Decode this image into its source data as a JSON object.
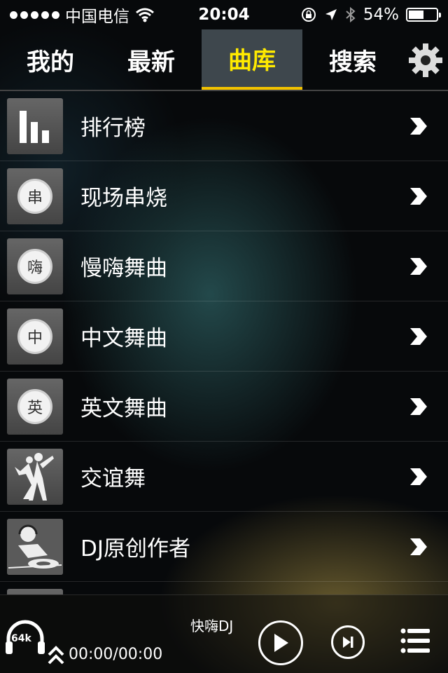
{
  "status_bar": {
    "carrier": "中国电信",
    "time": "20:04",
    "battery": "54%",
    "battery_level": 0.54
  },
  "tabs": [
    {
      "label": "我的",
      "active": false
    },
    {
      "label": "最新",
      "active": false
    },
    {
      "label": "曲库",
      "active": true
    },
    {
      "label": "搜索",
      "active": false
    }
  ],
  "colors": {
    "accent_yellow": "#ffea00",
    "tab_underline": "#f3c300",
    "active_tab_bg": "#3e474d"
  },
  "list": [
    {
      "label": "排行榜",
      "icon": "bar-chart-icon"
    },
    {
      "label": "现场串烧",
      "icon": "badge-icon",
      "badge": "串"
    },
    {
      "label": "慢嗨舞曲",
      "icon": "badge-icon",
      "badge": "嗨"
    },
    {
      "label": "中文舞曲",
      "icon": "badge-icon",
      "badge": "中"
    },
    {
      "label": "英文舞曲",
      "icon": "badge-icon",
      "badge": "英"
    },
    {
      "label": "交谊舞",
      "icon": "dancers-icon"
    },
    {
      "label": "DJ原创作者",
      "icon": "dj-icon"
    }
  ],
  "player": {
    "quality": "64k",
    "time": "00:00/00:00",
    "track": "快嗨DJ"
  }
}
